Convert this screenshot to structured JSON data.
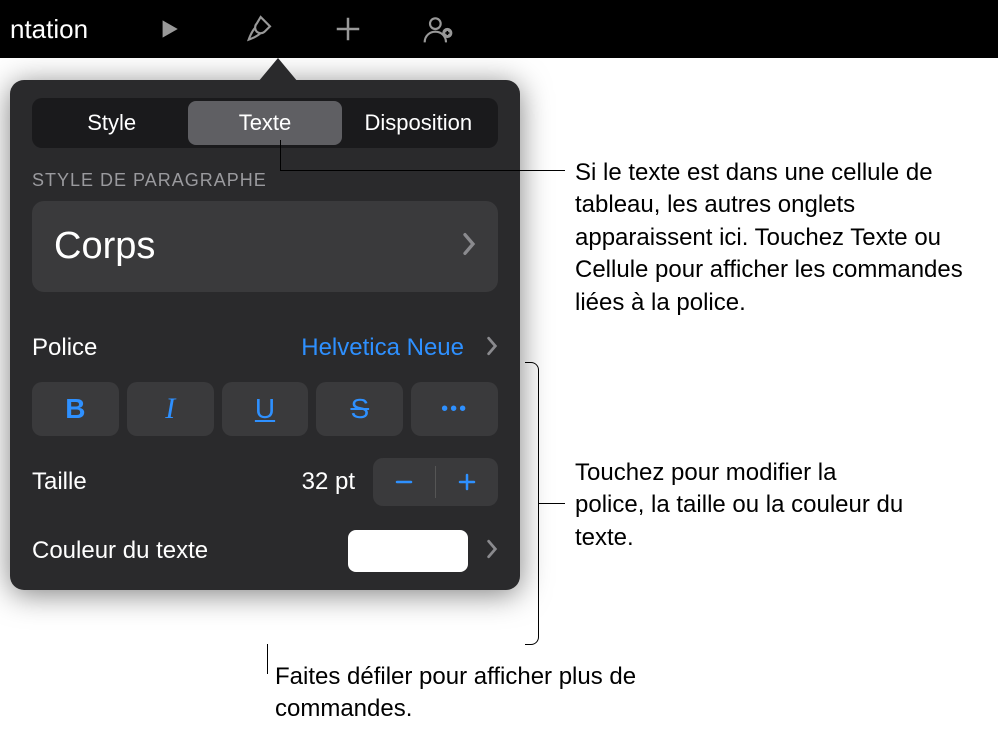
{
  "toolbar": {
    "left_text": "ntation"
  },
  "tabs": {
    "style": "Style",
    "text": "Texte",
    "layout": "Disposition"
  },
  "section": {
    "paragraph_style_label": "STYLE DE PARAGRAPHE",
    "paragraph_style_value": "Corps"
  },
  "font": {
    "label": "Police",
    "value": "Helvetica Neue"
  },
  "format": {
    "bold": "B",
    "italic": "I",
    "underline": "U",
    "strike": "S",
    "more": "•••"
  },
  "size": {
    "label": "Taille",
    "value": "32 pt"
  },
  "color": {
    "label": "Couleur du texte",
    "swatch_hex": "#ffffff"
  },
  "callouts": {
    "c1": "Si le texte est dans une cellule de tableau, les autres onglets apparaissent ici. Touchez Texte ou Cellule pour afficher les commandes liées à la police.",
    "c2": "Touchez pour modifier la police, la taille ou la couleur du texte.",
    "c3": "Faites défiler pour afficher plus de commandes."
  }
}
